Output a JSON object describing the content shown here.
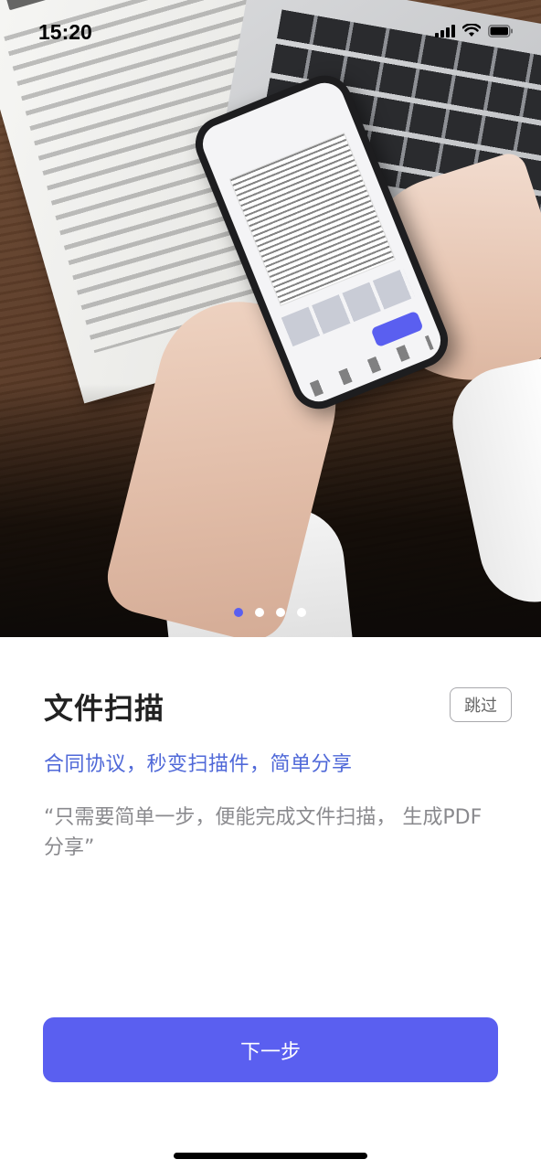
{
  "status_bar": {
    "time": "15:20"
  },
  "hero": {
    "image": "phone-scanning-document-photo",
    "pager": {
      "total": 4,
      "active_index": 0
    }
  },
  "content": {
    "title": "文件扫描",
    "skip_label": "跳过",
    "subtitle": "合同协议，秒变扫描件，简单分享",
    "description": "“只需要简单一步，便能完成文件扫描， 生成PDF分享”"
  },
  "footer": {
    "next_label": "下一步"
  },
  "colors": {
    "accent": "#5a5ff0",
    "subtitle": "#4f68d8",
    "description": "#8a8a8e",
    "title": "#222222"
  }
}
